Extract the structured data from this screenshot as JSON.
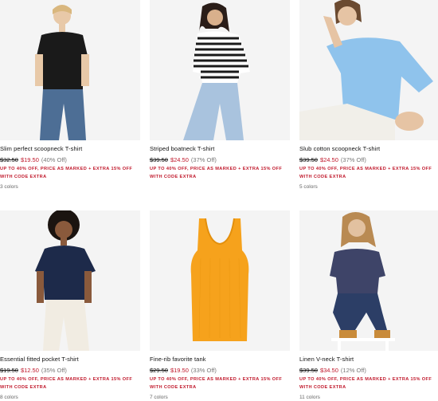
{
  "products": [
    {
      "name": "Slim perfect scoopneck T-shirt",
      "original_price": "$32.50",
      "sale_price": "$19.50",
      "discount": "(40% Off)",
      "promo": "UP TO 40% OFF, PRICE AS MARKED + EXTRA 15% OFF WITH CODE EXTRA",
      "colors": "3 colors"
    },
    {
      "name": "Striped boatneck T-shirt",
      "original_price": "$39.50",
      "sale_price": "$24.50",
      "discount": "(37% Off)",
      "promo": "UP TO 40% OFF, PRICE AS MARKED + EXTRA 15% OFF WITH CODE EXTRA",
      "colors": ""
    },
    {
      "name": "Slub cotton scoopneck T-shirt",
      "original_price": "$39.50",
      "sale_price": "$24.50",
      "discount": "(37% Off)",
      "promo": "UP TO 40% OFF, PRICE AS MARKED + EXTRA 15% OFF WITH CODE EXTRA",
      "colors": "5 colors"
    },
    {
      "name": "Essential fitted pocket T-shirt",
      "original_price": "$19.50",
      "sale_price": "$12.50",
      "discount": "(35% Off)",
      "promo": "UP TO 40% OFF, PRICE AS MARKED + EXTRA 15% OFF WITH CODE EXTRA",
      "colors": "8 colors"
    },
    {
      "name": "Fine-rib favorite tank",
      "original_price": "$29.50",
      "sale_price": "$19.50",
      "discount": "(33% Off)",
      "promo": "UP TO 40% OFF, PRICE AS MARKED + EXTRA 15% OFF WITH CODE EXTRA",
      "colors": "7 colors"
    },
    {
      "name": "Linen V-neck T-shirt",
      "original_price": "$39.50",
      "sale_price": "$34.50",
      "discount": "(12% Off)",
      "promo": "UP TO 40% OFF, PRICE AS MARKED + EXTRA 15% OFF WITH CODE EXTRA",
      "colors": "11 colors"
    }
  ],
  "colors": {
    "sale_red": "#c0182b",
    "image_bg": "#f3f3f3"
  }
}
